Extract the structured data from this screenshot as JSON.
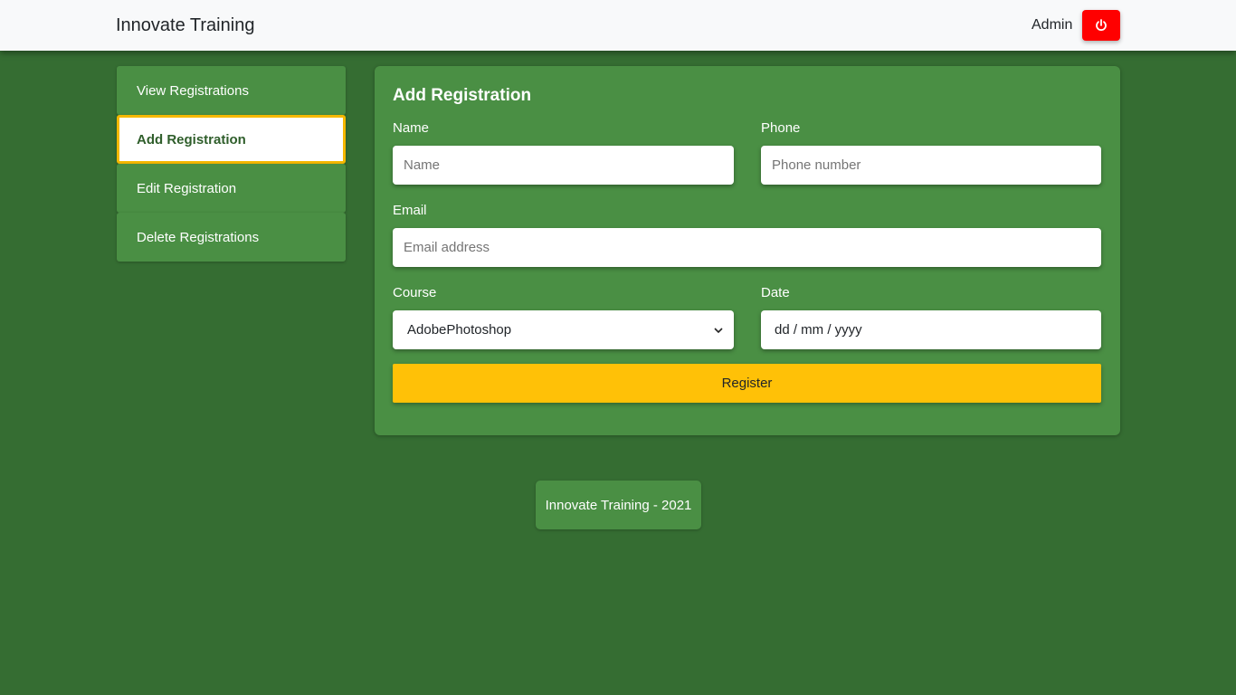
{
  "header": {
    "brand": "Innovate Training",
    "user": "Admin",
    "logout_icon": "power-icon"
  },
  "sidebar": {
    "items": [
      {
        "label": "View Registrations"
      },
      {
        "label": "Add Registration",
        "active": true
      },
      {
        "label": "Edit Registration"
      },
      {
        "label": "Delete Registrations"
      }
    ]
  },
  "form": {
    "title": "Add Registration",
    "name": {
      "label": "Name",
      "placeholder": "Name"
    },
    "phone": {
      "label": "Phone",
      "placeholder": "Phone number"
    },
    "email": {
      "label": "Email",
      "placeholder": "Email address"
    },
    "course": {
      "label": "Course",
      "value": "AdobePhotoshop"
    },
    "date": {
      "label": "Date",
      "value": "dd / mm / yyyy"
    },
    "submit": "Register"
  },
  "footer": {
    "text": "Innovate Training - 2021"
  }
}
